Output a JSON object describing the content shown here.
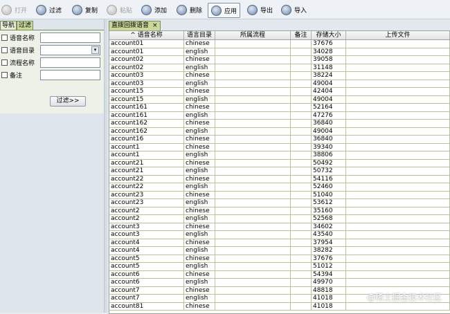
{
  "toolbar": {
    "buttons": [
      {
        "label": "打开",
        "disabled": true
      },
      {
        "label": "过滤",
        "disabled": false
      },
      {
        "label": "复制",
        "disabled": false
      },
      {
        "label": "粘贴",
        "disabled": true
      },
      {
        "label": "添加",
        "disabled": false
      },
      {
        "label": "删除",
        "disabled": false
      },
      {
        "label": "应用",
        "disabled": false,
        "active": true
      },
      {
        "label": "导出",
        "disabled": false
      },
      {
        "label": "导入",
        "disabled": false
      }
    ]
  },
  "left_tabs": [
    "导航",
    "过滤"
  ],
  "filter": {
    "fields": [
      {
        "label": "语音名称",
        "type": "text",
        "value": ""
      },
      {
        "label": "语音目录",
        "type": "select",
        "value": ""
      },
      {
        "label": "流程名称",
        "type": "text",
        "value": ""
      },
      {
        "label": "备注",
        "type": "text",
        "value": ""
      }
    ],
    "button_label": "过滤>>"
  },
  "doc_tab": {
    "label": "直拨回拨语音",
    "close": "×"
  },
  "grid": {
    "columns": [
      "^ 语音名称",
      "语言目录",
      "所属流程",
      "备注",
      "存储大小",
      "上传文件"
    ],
    "rows": [
      [
        "account01",
        "chinese",
        "",
        "",
        "37676",
        ""
      ],
      [
        "account01",
        "english",
        "",
        "",
        "34028",
        ""
      ],
      [
        "account02",
        "chinese",
        "",
        "",
        "39058",
        ""
      ],
      [
        "account02",
        "english",
        "",
        "",
        "31148",
        ""
      ],
      [
        "account03",
        "chinese",
        "",
        "",
        "38224",
        ""
      ],
      [
        "account03",
        "english",
        "",
        "",
        "49004",
        ""
      ],
      [
        "account15",
        "chinese",
        "",
        "",
        "42404",
        ""
      ],
      [
        "account15",
        "english",
        "",
        "",
        "49004",
        ""
      ],
      [
        "account161",
        "chinese",
        "",
        "",
        "52164",
        ""
      ],
      [
        "account161",
        "english",
        "",
        "",
        "47276",
        ""
      ],
      [
        "account162",
        "chinese",
        "",
        "",
        "36840",
        ""
      ],
      [
        "account162",
        "english",
        "",
        "",
        "49004",
        ""
      ],
      [
        "account16",
        "chinese",
        "",
        "",
        "36840",
        ""
      ],
      [
        "account1",
        "chinese",
        "",
        "",
        "39340",
        ""
      ],
      [
        "account1",
        "english",
        "",
        "",
        "38806",
        ""
      ],
      [
        "account21",
        "chinese",
        "",
        "",
        "50492",
        ""
      ],
      [
        "account21",
        "english",
        "",
        "",
        "50732",
        ""
      ],
      [
        "account22",
        "chinese",
        "",
        "",
        "54116",
        ""
      ],
      [
        "account22",
        "english",
        "",
        "",
        "52460",
        ""
      ],
      [
        "account23",
        "chinese",
        "",
        "",
        "51040",
        ""
      ],
      [
        "account23",
        "english",
        "",
        "",
        "53612",
        ""
      ],
      [
        "account2",
        "chinese",
        "",
        "",
        "35160",
        ""
      ],
      [
        "account2",
        "english",
        "",
        "",
        "52568",
        ""
      ],
      [
        "account3",
        "chinese",
        "",
        "",
        "34602",
        ""
      ],
      [
        "account3",
        "english",
        "",
        "",
        "43540",
        ""
      ],
      [
        "account4",
        "chinese",
        "",
        "",
        "37954",
        ""
      ],
      [
        "account4",
        "english",
        "",
        "",
        "38282",
        ""
      ],
      [
        "account5",
        "chinese",
        "",
        "",
        "37676",
        ""
      ],
      [
        "account5",
        "english",
        "",
        "",
        "51012",
        ""
      ],
      [
        "account6",
        "chinese",
        "",
        "",
        "54394",
        ""
      ],
      [
        "account6",
        "english",
        "",
        "",
        "49970",
        ""
      ],
      [
        "account7",
        "chinese",
        "",
        "",
        "48818",
        ""
      ],
      [
        "account7",
        "english",
        "",
        "",
        "41018",
        ""
      ],
      [
        "account81",
        "chinese",
        "",
        "",
        "41018",
        ""
      ]
    ]
  },
  "watermark": "@稀土掘金技术社区",
  "colors": {
    "tab_active": "#c9d99a",
    "grid_line": "#b6c49a"
  }
}
